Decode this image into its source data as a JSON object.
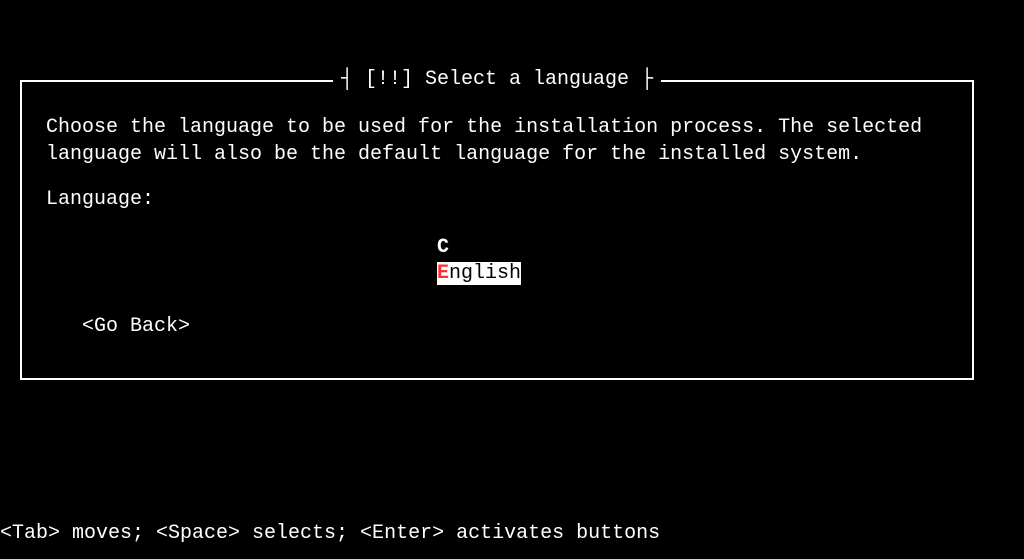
{
  "dialog": {
    "title_prefix": "┤",
    "title_text": " [!!] Select a language ",
    "title_suffix": "├",
    "description": "Choose the language to be used for the installation process. The selected language will also be the default language for the installed system.",
    "prompt": "Language:",
    "options": [
      {
        "shortcut": "C",
        "rest": "",
        "selected": false
      },
      {
        "shortcut": "E",
        "rest": "nglish",
        "selected": true
      }
    ],
    "back_label": "<Go Back>"
  },
  "help_bar": "<Tab> moves; <Space> selects; <Enter> activates buttons"
}
